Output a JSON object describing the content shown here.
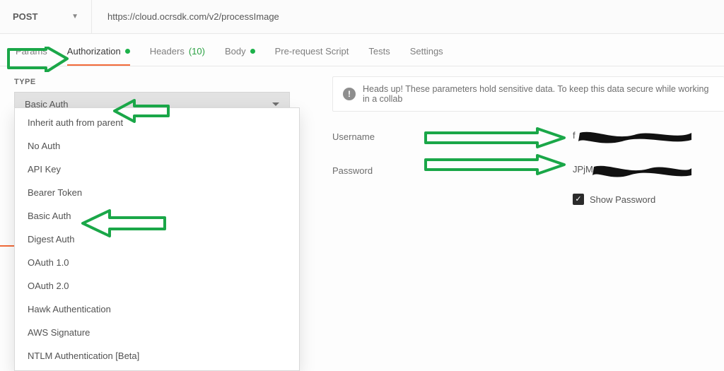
{
  "request": {
    "method": "POST",
    "url": "https://cloud.ocrsdk.com/v2/processImage"
  },
  "tabs": {
    "params": "Params",
    "auth": "Authorization",
    "headers_label": "Headers",
    "headers_count": "(10)",
    "body": "Body",
    "prerequest": "Pre-request Script",
    "tests": "Tests",
    "settings": "Settings"
  },
  "auth": {
    "type_label": "TYPE",
    "selected": "Basic Auth",
    "options": [
      "Inherit auth from parent",
      "No Auth",
      "API Key",
      "Bearer Token",
      "Basic Auth",
      "Digest Auth",
      "OAuth 1.0",
      "OAuth 2.0",
      "Hawk Authentication",
      "AWS Signature",
      "NTLM Authentication [Beta]"
    ]
  },
  "notice": "Heads up! These parameters hold sensitive data. To keep this data secure while working in a collab",
  "fields": {
    "username_label": "Username",
    "username_value": "f••••••••••",
    "password_label": "Password",
    "password_value": "JPjM••••••••••",
    "show_password_label": "Show Password",
    "show_password_checked": true
  },
  "colors": {
    "accent": "#f26b3a",
    "annotation": "#1aa748"
  },
  "body_tab_stub": "Bo"
}
